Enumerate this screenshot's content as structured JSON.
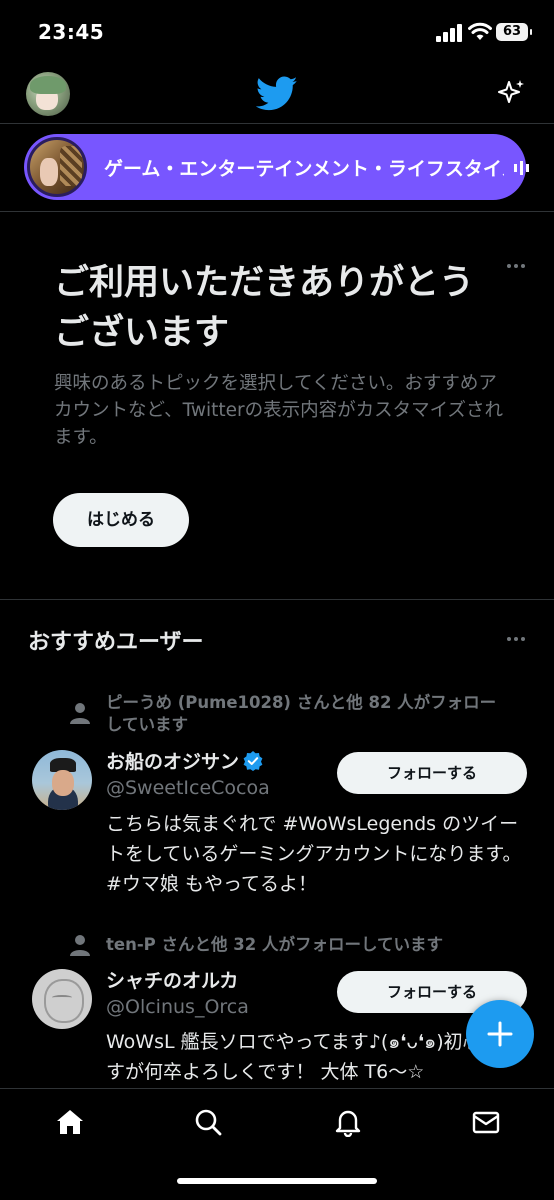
{
  "status_bar": {
    "time": "23:45",
    "battery": "63"
  },
  "spaces": {
    "title": "ゲーム・エンターテインメント・ライフスタイル"
  },
  "welcome": {
    "title": "ご利用いただきありがとうございます",
    "description": "興味のあるトピックを選択してください。おすすめアカウントなど、Twitterの表示内容がカスタマイズされます。",
    "button": "はじめる"
  },
  "suggested": {
    "title": "おすすめユーザー",
    "users": [
      {
        "social_context": "ピーうめ (Pume1028) さんと他 82 人がフォロー\nしています",
        "name": "お船のオジサン",
        "verified": true,
        "handle": "@SweetIceCocoa",
        "follow_label": "フォローする",
        "bio": "こちらは気まぐれで #WoWsLegends のツイートをしているゲーミングアカウントになります。#ウマ娘 もやってるよ！"
      },
      {
        "social_context": "ten-P さんと他 32 人がフォローしています",
        "name": "シャチのオルカ",
        "verified": false,
        "handle": "@Olcinus_Orca",
        "follow_label": "フォローする",
        "bio": "WoWsL 艦長ソロでやってます♪(๑❛ᴗ❛๑)初心者ですが何卒よろしくです！ 大体 T6〜☆"
      }
    ]
  },
  "icons": {
    "logo": "twitter-bird-icon",
    "sparkle": "sparkle-icon",
    "compose": "plus-icon",
    "tabs": [
      "home-icon",
      "search-icon",
      "bell-icon",
      "mail-icon"
    ]
  },
  "colors": {
    "accent": "#1d9bf0",
    "spaces": "#7856ff",
    "background": "#000000",
    "muted": "#71767b"
  }
}
